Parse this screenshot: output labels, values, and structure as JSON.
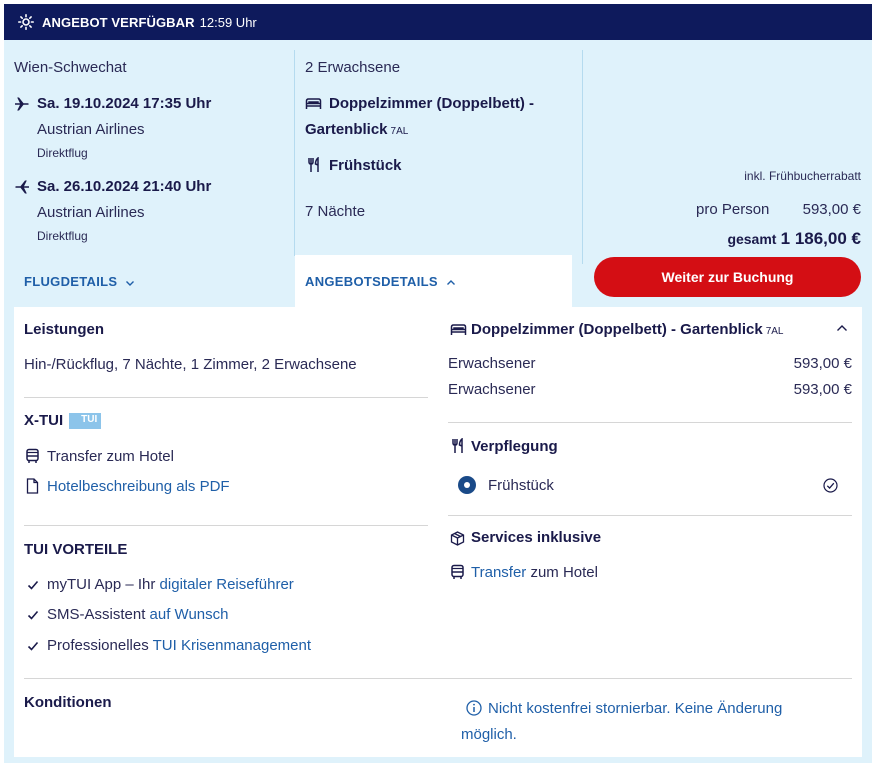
{
  "banner": {
    "title": "ANGEBOT VERFÜGBAR",
    "timer": "12:59 Uhr",
    "icon": "sun-icon"
  },
  "flight": {
    "airport": "Wien-Schwechat",
    "outbound": {
      "date": "Sa. 19.10.2024 17:35 Uhr",
      "airline": "Austrian Airlines",
      "type": "Direktflug"
    },
    "return": {
      "date": "Sa. 26.10.2024 21:40 Uhr",
      "airline": "Austrian Airlines",
      "type": "Direktflug"
    },
    "details_tab": "FLUGDETAILS"
  },
  "offer": {
    "travellers": "2 Erwachsene",
    "room_line1": "Doppelzimmer (Doppelbett) -",
    "room_line2": "Gartenblick",
    "room_code": "7AL",
    "board": "Frühstück",
    "nights": "7 Nächte",
    "details_tab": "ANGEBOTSDETAILS"
  },
  "price": {
    "discount_note": "inkl. Frühbucherrabatt",
    "per_person_label": "pro Person",
    "per_person_value": "593,00 €",
    "total_label": "gesamt",
    "total_value": "1 186,00 €",
    "book_button": "Weiter zur Buchung"
  },
  "details": {
    "leistungen_title": "Leistungen",
    "leistungen_text": "Hin-/Rückflug, 7 Nächte, 1 Zimmer, 2 Erwachsene",
    "xtui_title": "X-TUI",
    "xtui_badge": "TUI",
    "xtui_items": [
      "Transfer zum Hotel",
      "Hotelbeschreibung als PDF"
    ],
    "vorteile_title": "TUI VORTEILE",
    "vorteile": [
      {
        "plain": "myTUI App – Ihr ",
        "link": "digitaler Reiseführer"
      },
      {
        "plain": "SMS-Assistent ",
        "link": "auf Wunsch"
      },
      {
        "plain": "Professionelles ",
        "link": "TUI Krisenmanagement"
      }
    ],
    "room_title": "Doppelzimmer (Doppelbett) - Gartenblick",
    "room_code": "7AL",
    "room_prices": [
      {
        "label": "Erwachsener",
        "value": "593,00 €"
      },
      {
        "label": "Erwachsener",
        "value": "593,00 €"
      }
    ],
    "verpflegung_title": "Verpflegung",
    "verpflegung_option": "Frühstück",
    "services_title": "Services inklusive",
    "services_link": "Transfer",
    "services_rest": " zum Hotel",
    "konditionen_title": "Konditionen",
    "konditionen_line1": "Nicht kostenfrei stornierbar. Keine Änderung",
    "konditionen_line2": "möglich."
  },
  "colors": {
    "banner_bg": "#0e1a5c",
    "card_bg": "#dff2fb",
    "button_red": "#d40e14",
    "link_blue": "#1f5fa8",
    "text_navy": "#1a1a4a"
  }
}
